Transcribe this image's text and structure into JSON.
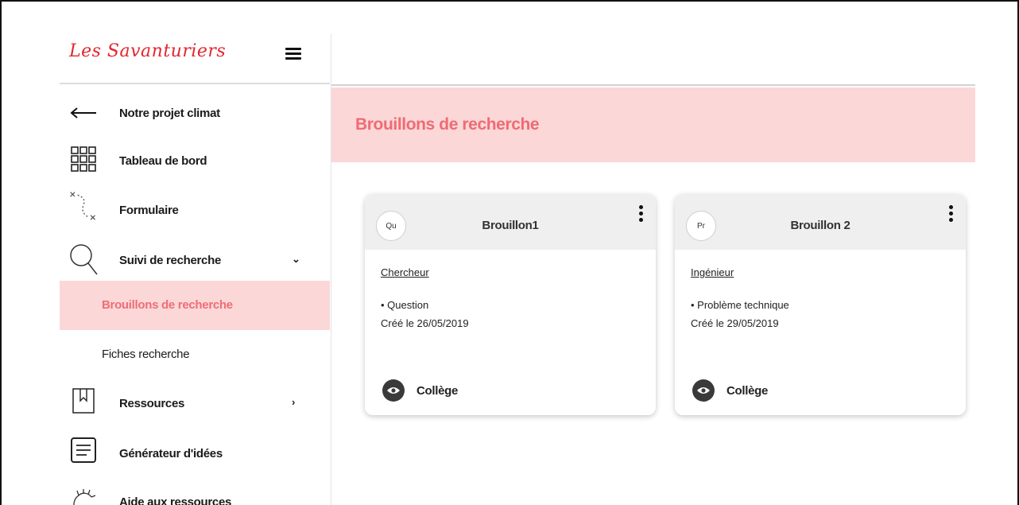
{
  "app": {
    "logo_text": "Les Savanturiers"
  },
  "sidebar": {
    "items": [
      {
        "label": "Notre projet climat",
        "icon": "arrow-left-icon"
      },
      {
        "label": "Tableau de bord",
        "icon": "grid-icon"
      },
      {
        "label": "Formulaire",
        "icon": "path-icon"
      },
      {
        "label": "Suivi de recherche",
        "icon": "search-icon",
        "caret": "⌄"
      },
      {
        "label": "Ressources",
        "icon": "book-icon",
        "caret": "›"
      },
      {
        "label": "Générateur d'idées",
        "icon": "document-icon"
      },
      {
        "label": "Aide aux ressources",
        "icon": "hand-icon"
      }
    ],
    "sub_items": [
      {
        "label": "Brouillons de recherche",
        "active": true
      },
      {
        "label": "Fiches recherche",
        "active": false
      }
    ]
  },
  "main": {
    "title": "Brouillons de recherche",
    "cards": [
      {
        "badge": "Qu",
        "title": "Brouillon1",
        "role": "Chercheur",
        "type": "• Question",
        "date": "Créé le 26/05/2019",
        "level": "Collège"
      },
      {
        "badge": "Pr",
        "title": "Brouillon 2",
        "role": "Ingénieur",
        "type": "• Problème technique",
        "date": "Créé le 29/05/2019",
        "level": "Collège"
      }
    ]
  },
  "colors": {
    "accent": "#ef6b73",
    "active_bg": "#fbd7d8",
    "logo": "#e3262d"
  }
}
